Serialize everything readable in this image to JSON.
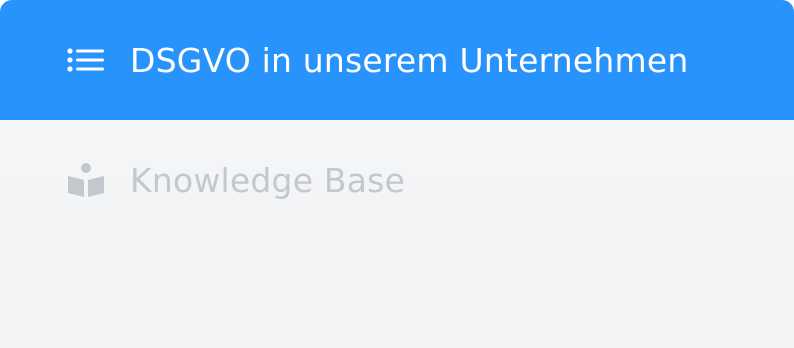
{
  "menu": {
    "items": [
      {
        "label": "DSGVO in unserem Unternehmen",
        "icon": "list-icon",
        "active": true
      },
      {
        "label": "Knowledge Base",
        "icon": "book-reader-icon",
        "active": false
      }
    ]
  },
  "colors": {
    "active_bg": "#2893fd",
    "active_text": "#ffffff",
    "inactive_text": "#c3c8cf",
    "inactive_icon": "#c3c8cf"
  }
}
